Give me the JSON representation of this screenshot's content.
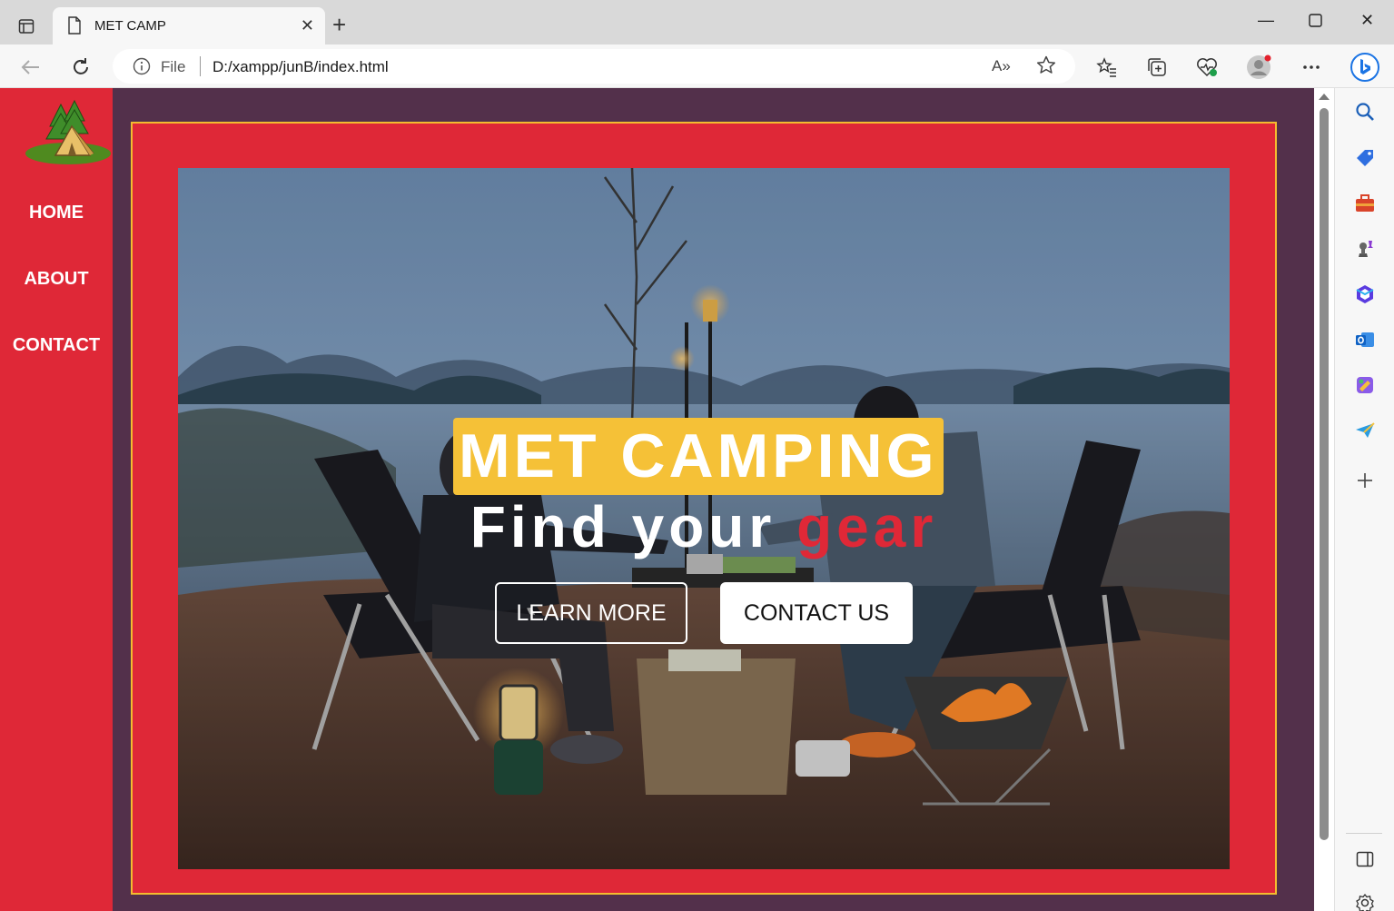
{
  "browser": {
    "tab_title": "MET CAMP",
    "address_scheme": "File",
    "address_url": "D:/xampp/junB/index.html",
    "read_aloud": "A»"
  },
  "site": {
    "nav": [
      "HOME",
      "ABOUT",
      "CONTACT"
    ],
    "hero": {
      "title": "MET CAMPING",
      "subtitle_main": "Find your",
      "subtitle_accent": "gear",
      "learn_more": "LEARN MORE",
      "contact_us": "CONTACT US"
    },
    "colors": {
      "nav_red": "#df2837",
      "page_bg": "#53304b",
      "title_highlight": "#f5c137",
      "frame_border": "#f3bc2f"
    }
  }
}
